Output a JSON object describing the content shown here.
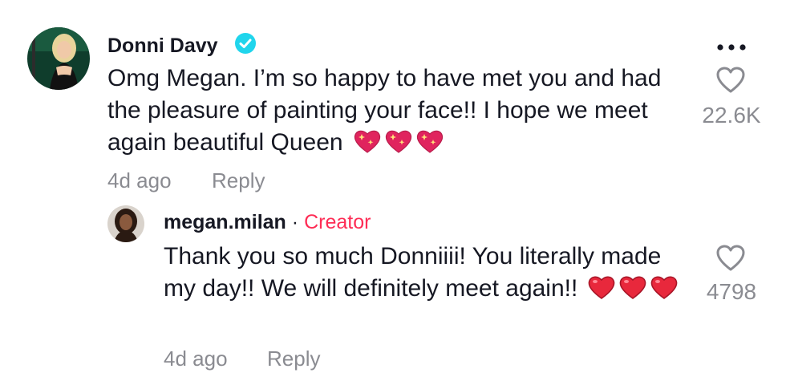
{
  "comment": {
    "username": "Donni Davy",
    "verified": true,
    "text": "Omg Megan. I’m so happy to have met you and had the pleasure of painting your face!! I hope we meet again beautiful Queen",
    "emojis": [
      "sparkling-heart",
      "sparkling-heart",
      "sparkling-heart"
    ],
    "time": "4d ago",
    "reply_label": "Reply",
    "like_count": "22.6K"
  },
  "reply": {
    "username": "megan.milan",
    "separator": "·",
    "badge": "Creator",
    "text": "Thank you so much Donniiii! You literally made my day!! We will definitely meet again!!",
    "emojis": [
      "red-heart",
      "red-heart",
      "red-heart"
    ],
    "time": "4d ago",
    "reply_label": "Reply",
    "like_count": "4798"
  },
  "colors": {
    "text": "#161823",
    "muted": "#8a8b91",
    "creator": "#fe2c55",
    "verified": "#20d5ec"
  }
}
